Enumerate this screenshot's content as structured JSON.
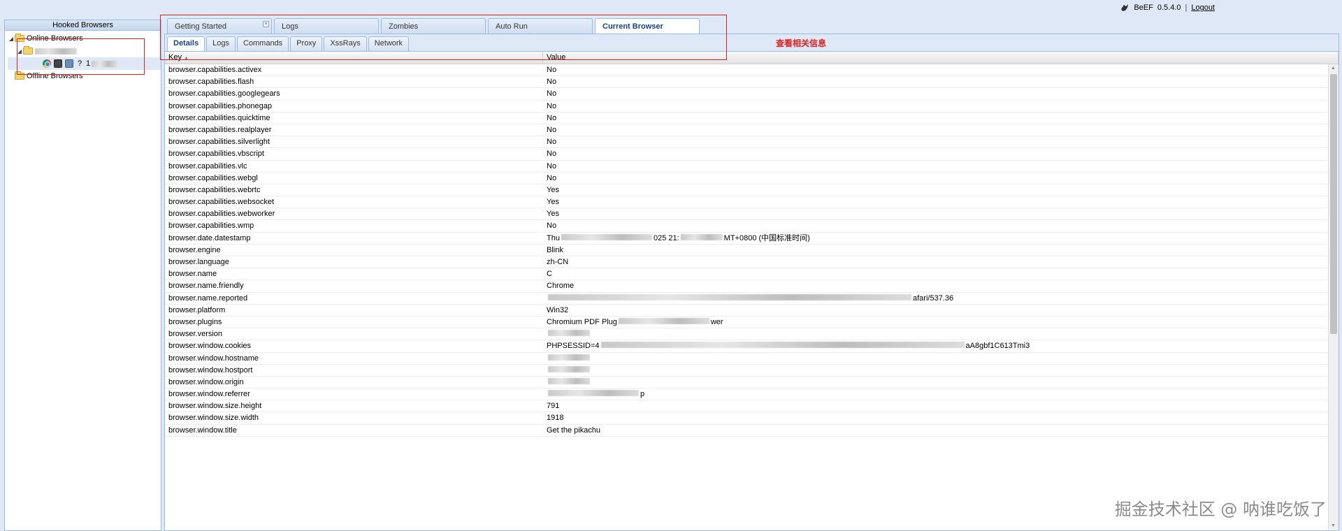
{
  "header": {
    "brand": "BeEF",
    "version": "0.5.4.0",
    "separator": "|",
    "logout": "Logout"
  },
  "left": {
    "title": "Hooked Browsers",
    "online": "Online Browsers",
    "offline": "Offline Browsers",
    "node_prefix": "1",
    "question": "?"
  },
  "tabs": {
    "top": [
      "Getting Started",
      "Logs",
      "Zombies",
      "Auto Run",
      "Current Browser"
    ],
    "top_active": 4,
    "close_glyph": "×",
    "sub": [
      "Details",
      "Logs",
      "Commands",
      "Proxy",
      "XssRays",
      "Network"
    ],
    "sub_active": 0
  },
  "annotation": "查看相关信息",
  "grid": {
    "key_header": "Key",
    "value_header": "Value",
    "sort_glyph": "▲",
    "rows": [
      {
        "key": "browser.capabilities.activex",
        "value": "No"
      },
      {
        "key": "browser.capabilities.flash",
        "value": "No"
      },
      {
        "key": "browser.capabilities.googlegears",
        "value": "No"
      },
      {
        "key": "browser.capabilities.phonegap",
        "value": "No"
      },
      {
        "key": "browser.capabilities.quicktime",
        "value": "No"
      },
      {
        "key": "browser.capabilities.realplayer",
        "value": "No"
      },
      {
        "key": "browser.capabilities.silverlight",
        "value": "No"
      },
      {
        "key": "browser.capabilities.vbscript",
        "value": "No"
      },
      {
        "key": "browser.capabilities.vlc",
        "value": "No"
      },
      {
        "key": "browser.capabilities.webgl",
        "value": "No"
      },
      {
        "key": "browser.capabilities.webrtc",
        "value": "Yes"
      },
      {
        "key": "browser.capabilities.websocket",
        "value": "Yes"
      },
      {
        "key": "browser.capabilities.webworker",
        "value": "Yes"
      },
      {
        "key": "browser.capabilities.wmp",
        "value": "No"
      },
      {
        "key": "browser.date.datestamp",
        "value": "Thu",
        "value_tail": "025 21:",
        "value_tail2": "MT+0800 (中国标准时间)"
      },
      {
        "key": "browser.engine",
        "value": "Blink"
      },
      {
        "key": "browser.language",
        "value": "zh-CN"
      },
      {
        "key": "browser.name",
        "value": "C"
      },
      {
        "key": "browser.name.friendly",
        "value": "Chrome"
      },
      {
        "key": "browser.name.reported",
        "value": "",
        "value_tail": "afari/537.36"
      },
      {
        "key": "browser.platform",
        "value": "Win32"
      },
      {
        "key": "browser.plugins",
        "value": "Chromium PDF Plug",
        "value_tail": "wer"
      },
      {
        "key": "browser.version",
        "value": ""
      },
      {
        "key": "browser.window.cookies",
        "value": "PHPSESSID=4",
        "value_tail": "aA8gbf1C613Tmi3"
      },
      {
        "key": "browser.window.hostname",
        "value": ""
      },
      {
        "key": "browser.window.hostport",
        "value": ""
      },
      {
        "key": "browser.window.origin",
        "value": ""
      },
      {
        "key": "browser.window.referrer",
        "value": "",
        "value_tail": "p"
      },
      {
        "key": "browser.window.size.height",
        "value": "791"
      },
      {
        "key": "browser.window.size.width",
        "value": "1918"
      },
      {
        "key": "browser.window.title",
        "value": "Get the pikachu"
      }
    ]
  },
  "watermark": "掘金技术社区 @ 呐谁吃饭了"
}
